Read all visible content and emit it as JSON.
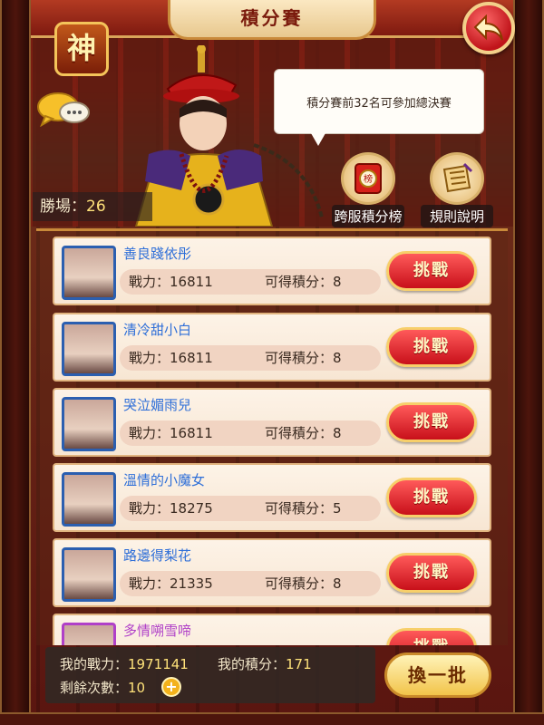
{
  "header": {
    "title": "積分賽",
    "shen_label": "神"
  },
  "hero": {
    "speech": "積分賽前32名可參加總決賽",
    "wins_label": "勝場：",
    "wins_value": "26"
  },
  "actions": {
    "cross_server_ranking": "跨服積分榜",
    "rules": "規則說明"
  },
  "opponents": [
    {
      "name": "善良踐依彤",
      "power_label": "戰力：",
      "power": "16811",
      "points_label": "可得積分：",
      "points": "8",
      "challenge": "挑戰"
    },
    {
      "name": "清冷甜小白",
      "power_label": "戰力：",
      "power": "16811",
      "points_label": "可得積分：",
      "points": "8",
      "challenge": "挑戰"
    },
    {
      "name": "哭泣媚雨兒",
      "power_label": "戰力：",
      "power": "16811",
      "points_label": "可得積分：",
      "points": "8",
      "challenge": "挑戰"
    },
    {
      "name": "溫情的小魔女",
      "power_label": "戰力：",
      "power": "18275",
      "points_label": "可得積分：",
      "points": "5",
      "challenge": "挑戰"
    },
    {
      "name": "路邊得梨花",
      "power_label": "戰力：",
      "power": "21335",
      "points_label": "可得積分：",
      "points": "8",
      "challenge": "挑戰"
    },
    {
      "name": "多情嗍雪啼",
      "power_label": "",
      "power": "",
      "points_label": "",
      "points": "",
      "challenge": "挑戰"
    }
  ],
  "footer": {
    "my_power_label": "我的戰力：",
    "my_power": "1971141",
    "my_points_label": "我的積分：",
    "my_points": "171",
    "remaining_label": "剩餘次數：",
    "remaining": "10",
    "refresh": "換一批"
  },
  "colors": {
    "name_blue": "#2f6fd8",
    "name_purple": "#b040c8",
    "challenge_red": "#c8101a",
    "gold": "#f4c45a"
  },
  "icons": {
    "back": "back-arrow-icon",
    "chat": "chat-bubble-icon",
    "ranking": "ranking-scroll-icon",
    "rules": "rules-scroll-icon",
    "plus": "plus-icon"
  }
}
